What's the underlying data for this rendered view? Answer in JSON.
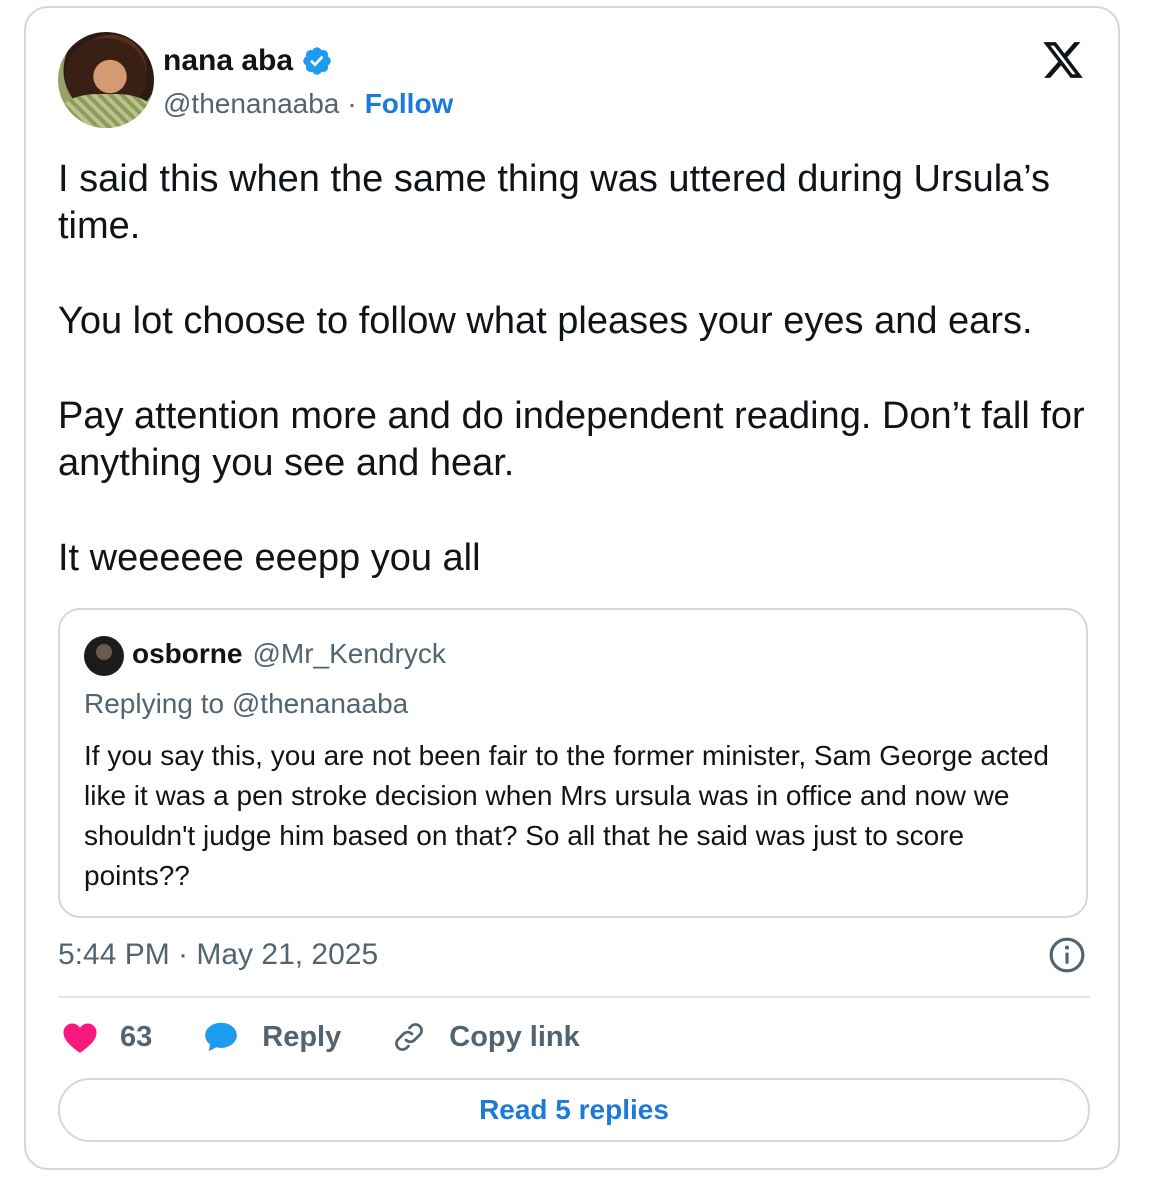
{
  "author": {
    "display_name": "nana aba",
    "handle": "@thenanaaba",
    "separator": "·",
    "follow_label": "Follow",
    "verified_icon": "verified-badge-icon",
    "verified_color": "#1d9bf0"
  },
  "brand_icon": "x-logo-icon",
  "tweet": {
    "paragraphs": [
      "I said this when the same thing was uttered during Ursula’s time.",
      "You lot choose to follow what pleases your eyes and ears.",
      "Pay attention more and do independent reading. Don’t fall for anything you see and hear.",
      "It weeeeee eeepp you all"
    ]
  },
  "quote": {
    "display_name": "osborne",
    "handle": "@Mr_Kendryck",
    "replying_to": "Replying to @thenanaaba",
    "text": "If you say this, you are not been fair to the former minister, Sam George acted like it was a pen stroke decision when Mrs ursula was in office and now we shouldn't judge him based on that? So all that he said was just to score points??"
  },
  "timestamp": "5:44 PM · May 21, 2025",
  "actions": {
    "like_count": "63",
    "reply_label": "Reply",
    "copy_link_label": "Copy link"
  },
  "read_replies_label": "Read 5 replies",
  "colors": {
    "link": "#1d7bd8",
    "like": "#f91880",
    "reply_bubble": "#1d9bf0",
    "muted_text": "#536471",
    "border": "#cfd9de"
  }
}
